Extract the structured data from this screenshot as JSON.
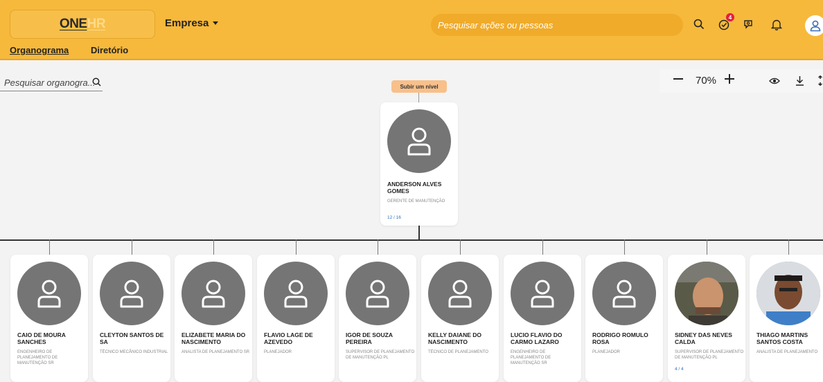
{
  "header": {
    "logo_one": "ONE",
    "logo_hr": "HR",
    "company": "Empresa",
    "search_placeholder": "Pesquisar ações ou pessoas",
    "notification_badge": "4",
    "icons": [
      "search-icon",
      "goals-icon",
      "feedback-icon",
      "bell-icon",
      "user-icon"
    ]
  },
  "subnav": {
    "tabs": [
      {
        "label": "Organograma",
        "active": true
      },
      {
        "label": "Diretório",
        "active": false
      }
    ]
  },
  "toolbar": {
    "org_search_placeholder": "Pesquisar organogra...",
    "zoom": "70%",
    "up_level": "Subir um nível"
  },
  "root": {
    "name": "ANDERSON ALVES GOMES",
    "role": "GERENTE DE MANUTENÇÃO",
    "count": "12 / 16"
  },
  "reports": [
    {
      "name": "CAIO DE MOURA SANCHES",
      "role": "ENGENHEIRO DE PLANEJAMENTO DE MANUTENÇÃO SR",
      "count": "",
      "photo": false
    },
    {
      "name": "CLEYTON SANTOS DE SA",
      "role": "TÉCNICO MECÂNICO INDUSTRIAL",
      "count": "",
      "photo": false
    },
    {
      "name": "ELIZABETE MARIA DO NASCIMENTO",
      "role": "ANALISTA DE PLANEJAMENTO SR",
      "count": "",
      "photo": false
    },
    {
      "name": "FLAVIO LAGE DE AZEVEDO",
      "role": "PLANEJADOR",
      "count": "",
      "photo": false
    },
    {
      "name": "IGOR DE SOUZA PEREIRA",
      "role": "SUPERVISOR DE PLANEJAMENTO DE MANUTENÇÃO PL",
      "count": "",
      "photo": false
    },
    {
      "name": "KELLY DAIANE DO NASCIMENTO",
      "role": "TÉCNICO DE PLANEJAMENTO",
      "count": "",
      "photo": false
    },
    {
      "name": "LUCIO FLAVIO DO CARMO LAZARO",
      "role": "ENGENHEIRO DE PLANEJAMENTO DE MANUTENÇÃO SR",
      "count": "",
      "photo": false
    },
    {
      "name": "RODRIGO ROMULO ROSA",
      "role": "PLANEJADOR",
      "count": "",
      "photo": false
    },
    {
      "name": "SIDNEY DAS NEVES CALDA",
      "role": "SUPERVISOR DE PLANEJAMENTO DE MANUTENÇÃO PL",
      "count": "4 / 4",
      "photo": true
    },
    {
      "name": "THIAGO MARTINS SANTOS COSTA",
      "role": "ANALISTA DE PLANEJAMENTO",
      "count": "",
      "photo": true
    }
  ],
  "colors": {
    "brand": "#f6b93b",
    "avatar_gray": "#757575",
    "link_blue": "#2f6fba",
    "badge_red": "#e0213d"
  }
}
